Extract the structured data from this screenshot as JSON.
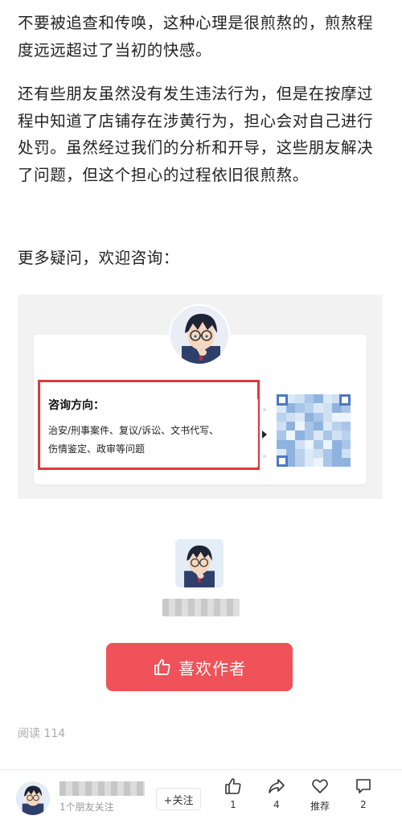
{
  "article": {
    "para1": "不要被追查和传唤，这种心理是很煎熬的，煎熬程度远远超过了当初的快感。",
    "para2": "还有些朋友虽然没有发生违法行为，但是在按摩过程中知道了店铺存在涉黄行为，担心会对自己进行处罚。虽然经过我们的分析和开导，这些朋友解决了问题，但这个担心的过程依旧很煎熬。",
    "para3": "更多疑问，欢迎咨询："
  },
  "card": {
    "title": "咨询方向：",
    "line1": "治安/刑事案件、复议/诉讼、文书代写、",
    "line2": "伤情鉴定、政审等问题"
  },
  "author": {
    "like_label": "喜欢作者"
  },
  "stats": {
    "read_label": "阅读 114"
  },
  "bottom_bar": {
    "follow_count": "1个朋友关注",
    "follow_label": "+关注",
    "like_count": "1",
    "share_count": "4",
    "recommend_label": "推荐",
    "comment_count": "2"
  },
  "colors": {
    "accent": "#f0525a",
    "box_border": "#e0363e"
  },
  "icons": [
    "thumb-up-icon",
    "share-icon",
    "heart-icon",
    "comment-icon",
    "play-triangle-icon"
  ]
}
